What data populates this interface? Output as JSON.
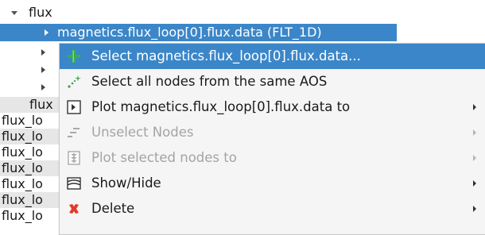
{
  "tree": {
    "root_label": "flux",
    "selected_node_label": "magnetics.flux_loop[0].flux.data (FLT_1D)",
    "partial_labels": [
      "flux",
      "flux_lo",
      "flux_lo",
      "flux_lo",
      "flux_lo",
      "flux_lo",
      "flux_lo",
      "flux_lo"
    ]
  },
  "context_menu": {
    "items": [
      {
        "label": "Select magnetics.flux_loop[0].flux.data...",
        "icon": "plus-icon",
        "highlighted": true,
        "disabled": false,
        "submenu": false
      },
      {
        "label": "Select all nodes from the same AOS",
        "icon": "sparkle-icon",
        "highlighted": false,
        "disabled": false,
        "submenu": false
      },
      {
        "label": "Plot magnetics.flux_loop[0].flux.data to",
        "icon": "plot-icon",
        "highlighted": false,
        "disabled": false,
        "submenu": true
      },
      {
        "label": "Unselect Nodes",
        "icon": "unselect-icon",
        "highlighted": false,
        "disabled": true,
        "submenu": true
      },
      {
        "label": "Plot selected nodes to",
        "icon": "plot-selected-icon",
        "highlighted": false,
        "disabled": true,
        "submenu": true
      },
      {
        "label": "Show/Hide",
        "icon": "layers-icon",
        "highlighted": false,
        "disabled": false,
        "submenu": true
      },
      {
        "label": "Delete",
        "icon": "delete-icon",
        "highlighted": false,
        "disabled": false,
        "submenu": true
      }
    ]
  },
  "colors": {
    "selection": "#3b86c8",
    "menu_background": "#f5f5f5",
    "plus_icon": "#35b04a",
    "delete_icon": "#e23a2e",
    "disabled_text": "#a4a4a4"
  }
}
